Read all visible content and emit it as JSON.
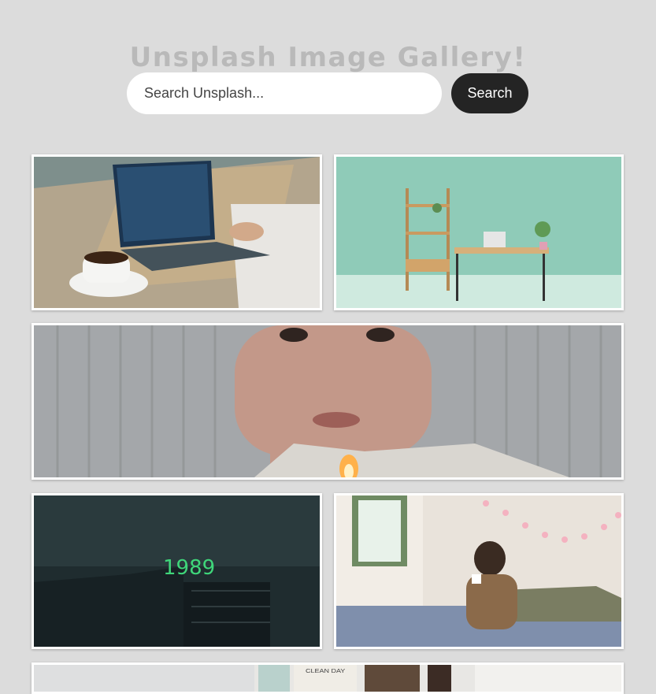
{
  "header": {
    "title": "Unsplash Image Gallery!"
  },
  "search": {
    "placeholder": "Search Unsplash...",
    "button_label": "Search"
  },
  "gallery": {
    "photos": [
      {
        "name": "laptop-coffee-photo",
        "overlay_text": ""
      },
      {
        "name": "green-desk-shelf-photo",
        "overlay_text": ""
      },
      {
        "name": "man-face-lighter-photo",
        "overlay_text": ""
      },
      {
        "name": "dark-building-neon-photo",
        "overlay_text": "1989"
      },
      {
        "name": "woman-bed-lights-photo",
        "overlay_text": ""
      },
      {
        "name": "kitchen-counter-photo",
        "overlay_text": "CLEAN DAY"
      }
    ]
  },
  "colors": {
    "background": "#dcdcdc",
    "title": "#b9b9b9",
    "button": "#242424"
  }
}
